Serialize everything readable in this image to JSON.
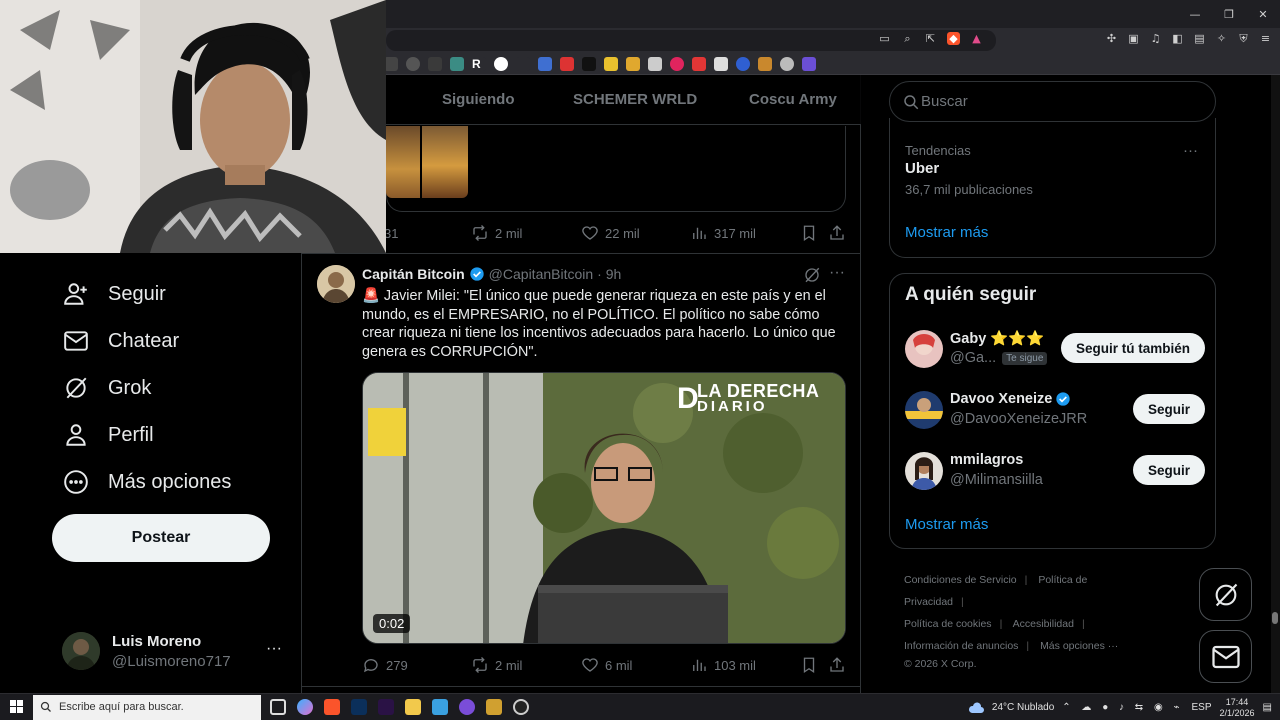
{
  "nav": {
    "items": [
      {
        "label": "Seguir",
        "icon": "add-person-icon"
      },
      {
        "label": "Chatear",
        "icon": "envelope-icon"
      },
      {
        "label": "Grok",
        "icon": "grok-icon"
      },
      {
        "label": "Perfil",
        "icon": "person-icon"
      },
      {
        "label": "Más opciones",
        "icon": "more-circle-icon"
      }
    ],
    "post_label": "Postear",
    "profile": {
      "name": "Luis Moreno",
      "handle": "@Luismoreno717",
      "more": "···"
    }
  },
  "tabs": [
    "Siguiendo",
    "SCHEMER WRLD",
    "Coscu Army"
  ],
  "prev_tweet": {
    "replies": "31",
    "reposts": "2 mil",
    "likes": "22 mil",
    "views": "317 mil"
  },
  "tweet": {
    "name": "Capitán Bitcoin",
    "handle": "@CapitanBitcoin",
    "time": "· 9h",
    "text": "🚨 Javier Milei: \"El único que puede generar riqueza en este país y en el mundo, es el EMPRESARIO, no el POLÍTICO. El político no sabe cómo crear riqueza ni tiene los incentivos adecuados para hacerlo. Lo único que genera es CORRUPCIÓN\".",
    "media_logo_line1": "LA DERECHA",
    "media_logo_line2": "DIARIO",
    "duration": "0:02",
    "replies": "279",
    "reposts": "2 mil",
    "likes": "6 mil",
    "views": "103 mil"
  },
  "search": {
    "placeholder": "Buscar"
  },
  "trends": {
    "category": "Tendencias",
    "name": "Uber",
    "count": "36,7 mil publicaciones",
    "show_more": "Mostrar más"
  },
  "who_to_follow": {
    "title": "A quién seguir",
    "users": [
      {
        "name": "Gaby ⭐⭐⭐",
        "handle": "@Ga...",
        "badge": "Te sigue",
        "button": "Seguir tú también"
      },
      {
        "name": "Davoo Xeneize",
        "handle": "@DavooXeneizeJRR",
        "button": "Seguir"
      },
      {
        "name": "mmilagros",
        "handle": "@Milimansiilla",
        "button": "Seguir"
      }
    ],
    "show_more": "Mostrar más"
  },
  "footer": {
    "terms": "Condiciones de Servicio",
    "privacy": "Política de Privacidad",
    "cookies": "Política de cookies",
    "accessibility": "Accesibilidad",
    "ads": "Información de anuncios",
    "more": "Más opciones ···",
    "copyright": "© 2026 X Corp."
  },
  "taskbar": {
    "search_placeholder": "Escribe aquí para buscar.",
    "weather": "24°C  Nublado",
    "lang": "ESP",
    "time": "17:44",
    "date": "2/1/2026"
  },
  "colors": {
    "accent": "#1d9bf0",
    "background": "#000000",
    "border": "#2f3336"
  }
}
